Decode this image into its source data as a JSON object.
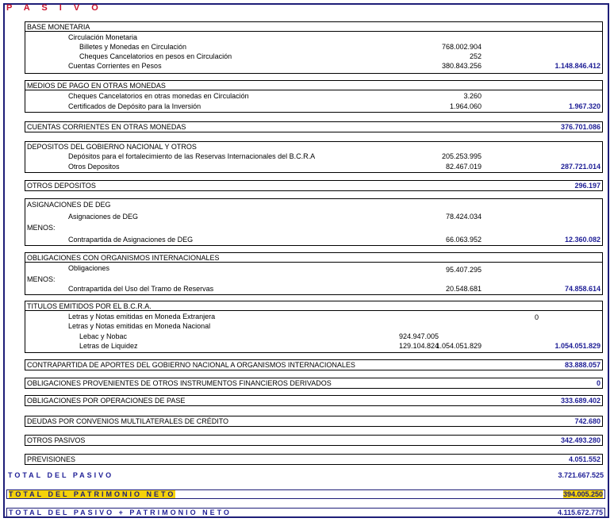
{
  "header": {
    "title": "P A S I V O"
  },
  "base_monetaria": {
    "title": "BASE MONETARIA",
    "circulacion": "Circulación Monetaria",
    "billetes_label": "Billetes y Monedas en Circulación",
    "billetes_value": "768.002.904",
    "cheques_label": "Cheques Cancelatorios en pesos en Circulación",
    "cheques_value": "252",
    "cuentas_label": "Cuentas Corrientes en Pesos",
    "cuentas_value": "380.843.256",
    "total": "1.148.846.412"
  },
  "medios_pago": {
    "title": "MEDIOS DE PAGO EN OTRAS MONEDAS",
    "cheques_label": "Cheques Cancelatorios en otras monedas en Circulación",
    "cheques_value": "3.260",
    "certificados_label": "Certificados de Depósito para la Inversión",
    "certificados_value": "1.964.060",
    "total": "1.967.320"
  },
  "cuentas_corrientes": {
    "title": "CUENTAS CORRIENTES EN OTRAS MONEDAS",
    "total": "376.701.086"
  },
  "depositos_gobierno": {
    "title": "DEPOSITOS DEL GOBIERNO NACIONAL Y OTROS",
    "fortalecimiento_label": "Depósitos para el fortalecimiento de las Reservas Internacionales del B.C.R.A",
    "fortalecimiento_value": "205.253.995",
    "otros_label": "Otros Depositos",
    "otros_value": "82.467.019",
    "total": "287.721.014"
  },
  "otros_depositos": {
    "title": "OTROS DEPOSITOS",
    "total": "296.197"
  },
  "asignaciones_deg": {
    "title": "ASIGNACIONES DE DEG",
    "asignaciones_label": "Asignaciones de DEG",
    "asignaciones_value": "78.424.034",
    "menos": "MENOS:",
    "contrapartida_label": "Contrapartida de Asignaciones de DEG",
    "contrapartida_value": "66.063.952",
    "total": "12.360.082"
  },
  "obligaciones_org": {
    "title": "OBLIGACIONES CON ORGANISMOS INTERNACIONALES",
    "obligaciones_label": "Obligaciones",
    "obligaciones_value": "95.407.295",
    "menos": "MENOS:",
    "contrapartida_label": "Contrapartida del Uso del Tramo de Reservas",
    "contrapartida_value": "20.548.681",
    "total": "74.858.614"
  },
  "titulos": {
    "title": "TITULOS EMITIDOS POR EL B.C.R.A.",
    "letras_ext_label": "Letras y Notas emitidas en Moneda Extranjera",
    "letras_ext_value": "0",
    "letras_nac_label": "Letras y Notas emitidas en Moneda Nacional",
    "lebac_label": "Lebac y Nobac",
    "lebac_value": "924.947.005",
    "liquidez_label": "Letras de Liquidez",
    "liquidez_value": "129.104.824",
    "subtotal": "1.054.051.829",
    "total": "1.054.051.829"
  },
  "contrapartida_aportes": {
    "title": "CONTRAPARTIDA DE APORTES DEL GOBIERNO NACIONAL A ORGANISMOS INTERNACIONALES",
    "total": "83.888.057"
  },
  "obligaciones_derivados": {
    "title": "OBLIGACIONES PROVENIENTES DE OTROS INSTRUMENTOS FINANCIEROS DERIVADOS",
    "total": "0"
  },
  "obligaciones_pase": {
    "title": "OBLIGACIONES POR OPERACIONES DE PASE",
    "total": "333.689.402"
  },
  "deudas_convenios": {
    "title": "DEUDAS POR CONVENIOS MULTILATERALES DE CRÉDITO",
    "total": "742.680"
  },
  "otros_pasivos": {
    "title": "OTROS PASIVOS",
    "total": "342.493.280"
  },
  "previsiones": {
    "title": "PREVISIONES",
    "total": "4.051.552"
  },
  "total_pasivo": {
    "label": "TOTAL DEL PASIVO",
    "value": "3.721.667.525"
  },
  "total_patrimonio": {
    "label": "TOTAL DEL PATRIMONIO NETO",
    "value": "394.005.250"
  },
  "total_general": {
    "label": "TOTAL DEL PASIVO + PATRIMONIO NETO",
    "value": "4.115.672.775"
  },
  "colors": {
    "frame": "#1e1e78",
    "title_red": "#c8142d",
    "total_blue": "#1e1e96",
    "highlight": "#f5d20a"
  }
}
